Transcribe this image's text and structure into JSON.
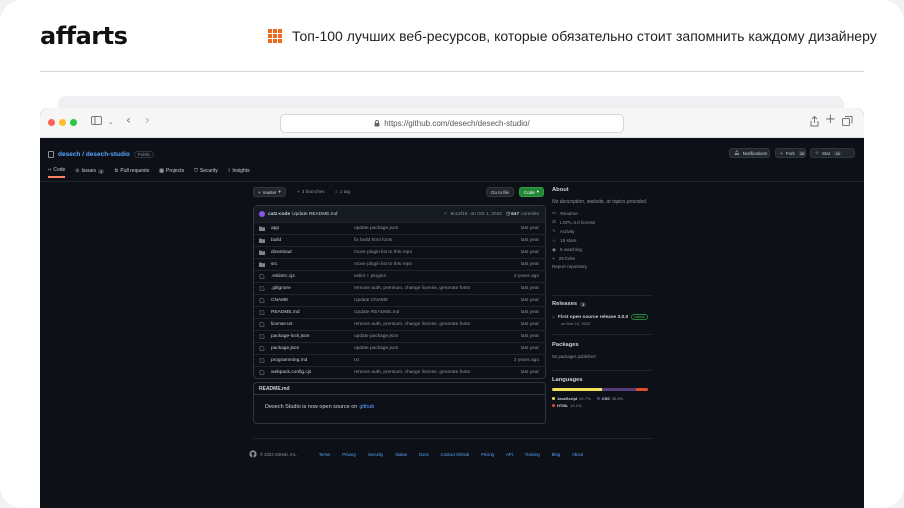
{
  "brand": {
    "logo": "affarts"
  },
  "headline": "Топ-100 лучших веб-ресурсов, которые обязательно стоит запомнить каждому дизайнеру",
  "browser": {
    "url": "https://github.com/desech/desech-studio/"
  },
  "repo": {
    "owner_repo": "desech / desech-studio",
    "visibility": "Public",
    "notifications_label": "Notifications",
    "fork_label": "Fork",
    "fork_count": "28",
    "star_label": "Star",
    "star_count": "18"
  },
  "tabs": [
    {
      "label": "Code"
    },
    {
      "label": "Issues",
      "count": "3"
    },
    {
      "label": "Pull requests"
    },
    {
      "label": "Projects"
    },
    {
      "label": "Security"
    },
    {
      "label": "Insights"
    }
  ],
  "toolbar": {
    "branch": "master",
    "branches": "3 branches",
    "tags": "1 tag",
    "go_to_file": "Go to file",
    "code": "Code"
  },
  "commit": {
    "author": "catz-code",
    "message": "Update README.md",
    "hash": "8cc2f15",
    "date": "on Oct 1, 2022",
    "count": "647",
    "commits_label": "commits"
  },
  "files": [
    {
      "name": "app",
      "type": "dir",
      "message": "update package.json",
      "time": "last year"
    },
    {
      "name": "build",
      "type": "dir",
      "message": "fix build html fonts",
      "time": "last year"
    },
    {
      "name": "download",
      "type": "dir",
      "message": "move plugin list to this repo",
      "time": "last year"
    },
    {
      "name": "src",
      "type": "dir",
      "message": "move plugin list to this repo",
      "time": "last year"
    },
    {
      "name": ".eslintrc.cjs",
      "type": "file",
      "message": "eslint + plugins",
      "time": "2 years ago"
    },
    {
      "name": ".gitignore",
      "type": "file",
      "message": "remove auth, premium, change license, generate fonts",
      "time": "last year"
    },
    {
      "name": "CNAME",
      "type": "file",
      "message": "Update CNAME",
      "time": "last year"
    },
    {
      "name": "README.md",
      "type": "file",
      "message": "Update README.md",
      "time": "last year"
    },
    {
      "name": "license.txt",
      "type": "file",
      "message": "remove auth, premium, change license, generate fonts",
      "time": "last year"
    },
    {
      "name": "package-lock.json",
      "type": "file",
      "message": "update package.json",
      "time": "last year"
    },
    {
      "name": "package.json",
      "type": "file",
      "message": "update package.json",
      "time": "last year"
    },
    {
      "name": "programming.md",
      "type": "file",
      "message": "txt",
      "time": "2 years ago"
    },
    {
      "name": "webpack.config.cjs",
      "type": "file",
      "message": "remove auth, premium, change license, generate fonts",
      "time": "last year"
    }
  ],
  "readme": {
    "title": "README.md",
    "text": "Desech Studio is now open source on",
    "link": "github"
  },
  "about": {
    "title": "About",
    "description": "No description, website, or topics provided.",
    "items": [
      "Readme",
      "LGPL-3.0 license",
      "Activity",
      "15 stars",
      "6 watching",
      "28 forks"
    ],
    "report": "Report repository"
  },
  "releases": {
    "title": "Releases",
    "count": "1",
    "name": "First open source release 3.0.0",
    "latest": "Latest",
    "date": "on Dec 14, 2022"
  },
  "packages": {
    "title": "Packages",
    "text": "No packages published"
  },
  "languages": {
    "title": "Languages",
    "list": [
      {
        "name": "JavaScript",
        "pct": "52.7%",
        "value": 52.7,
        "color": "#f1e05a"
      },
      {
        "name": "CSS",
        "pct": "35.8%",
        "value": 35.8,
        "color": "#563d7c"
      },
      {
        "name": "HTML",
        "pct": "12.1%",
        "value": 12.1,
        "color": "#e34c26"
      }
    ]
  },
  "footer": {
    "copyright": "© 2023 GitHub, Inc.",
    "links": [
      "Terms",
      "Privacy",
      "Security",
      "Status",
      "Docs",
      "Contact GitHub",
      "Pricing",
      "API",
      "Training",
      "Blog",
      "About"
    ]
  }
}
